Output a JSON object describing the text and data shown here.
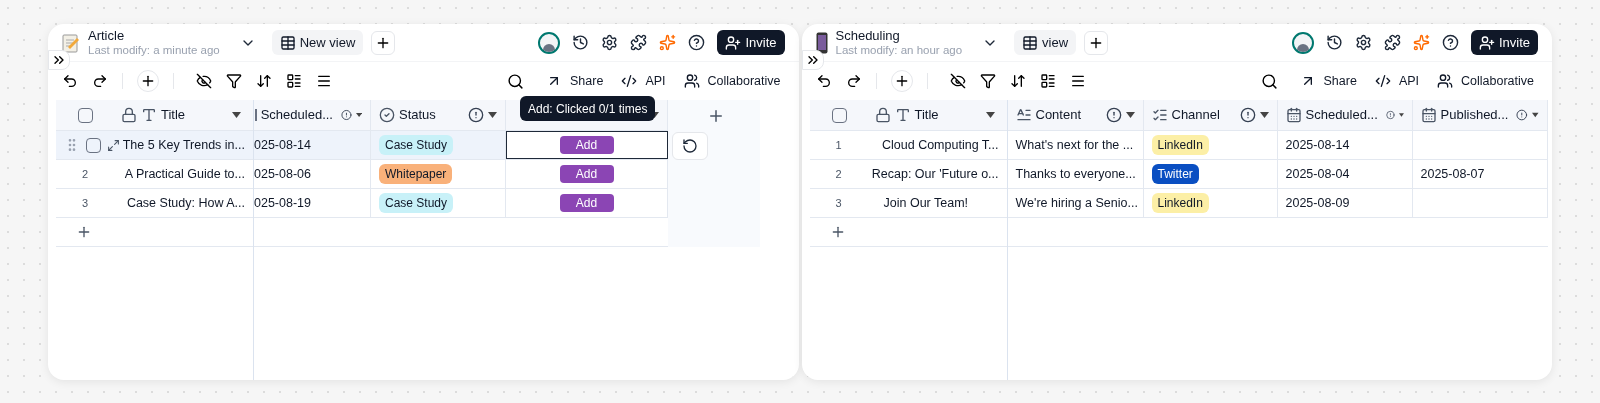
{
  "panels": [
    {
      "title": "Article",
      "subtitle": "Last modify: a minute ago",
      "view_label": "New view",
      "invite_label": "Invite",
      "toolbar_right": [
        "Share",
        "API",
        "Collaborative"
      ],
      "all_selected": false,
      "columns": [
        {
          "kind": "title",
          "label": "Title"
        },
        {
          "kind": "date",
          "label": "Scheduled...",
          "cut": true
        },
        {
          "kind": "status",
          "label": "Status"
        },
        {
          "kind": "button"
        }
      ],
      "tooltip": "Add: Clicked 0/1 times",
      "rows": [
        {
          "selected": true,
          "cells": [
            {
              "kind": "text",
              "text": "The 5 Key Trends in..."
            },
            {
              "kind": "text",
              "text": "025-08-14"
            },
            {
              "kind": "tag",
              "text": "Case Study",
              "color": "#c8f1f8"
            },
            {
              "kind": "button",
              "text": "Add",
              "focused": true
            }
          ]
        },
        {
          "selected": false,
          "number": "2",
          "cells": [
            {
              "kind": "text",
              "text": "A Practical Guide to..."
            },
            {
              "kind": "text",
              "text": "025-08-06"
            },
            {
              "kind": "tag",
              "text": "Whitepaper",
              "color": "#f9b17a"
            },
            {
              "kind": "button",
              "text": "Add",
              "focused": false
            }
          ]
        },
        {
          "selected": false,
          "number": "3",
          "cells": [
            {
              "kind": "text",
              "text": "Case Study: How A..."
            },
            {
              "kind": "text",
              "text": "025-08-19"
            },
            {
              "kind": "tag",
              "text": "Case Study",
              "color": "#c8f1f8"
            },
            {
              "kind": "button",
              "text": "Add",
              "focused": false
            }
          ]
        }
      ]
    },
    {
      "title": "Scheduling",
      "subtitle": "Last modify: an hour ago",
      "view_label": "view",
      "invite_label": "Invite",
      "toolbar_right": [
        "Share",
        "API",
        "Collaborative"
      ],
      "all_selected": false,
      "columns": [
        {
          "kind": "title",
          "label": "Title"
        },
        {
          "kind": "content",
          "label": "Content"
        },
        {
          "kind": "channel",
          "label": "Channel"
        },
        {
          "kind": "date",
          "label": "Scheduled..."
        },
        {
          "kind": "date",
          "label": "Published..."
        }
      ],
      "rows": [
        {
          "selected": false,
          "number": "1",
          "cells": [
            {
              "kind": "text",
              "text": "Cloud Computing T..."
            },
            {
              "kind": "text",
              "text": "What's next for the ..."
            },
            {
              "kind": "tag",
              "text": "LinkedIn",
              "color": "#fcefa6"
            },
            {
              "kind": "text",
              "text": "2025-08-14"
            },
            {
              "kind": "text",
              "text": ""
            }
          ]
        },
        {
          "selected": false,
          "number": "2",
          "cells": [
            {
              "kind": "text",
              "text": "Recap: Our 'Future o..."
            },
            {
              "kind": "text",
              "text": "Thanks to everyone..."
            },
            {
              "kind": "tag",
              "text": "Twitter",
              "color": "#0a4fc2"
            },
            {
              "kind": "text",
              "text": "2025-08-04"
            },
            {
              "kind": "text",
              "text": "2025-08-07"
            }
          ]
        },
        {
          "selected": false,
          "number": "3",
          "cells": [
            {
              "kind": "text",
              "text": "Join Our Team!"
            },
            {
              "kind": "text",
              "text": "We're hiring a Senio..."
            },
            {
              "kind": "tag",
              "text": "LinkedIn",
              "color": "#fcefa6"
            },
            {
              "kind": "text",
              "text": "2025-08-09"
            },
            {
              "kind": "text",
              "text": ""
            }
          ]
        }
      ]
    }
  ]
}
